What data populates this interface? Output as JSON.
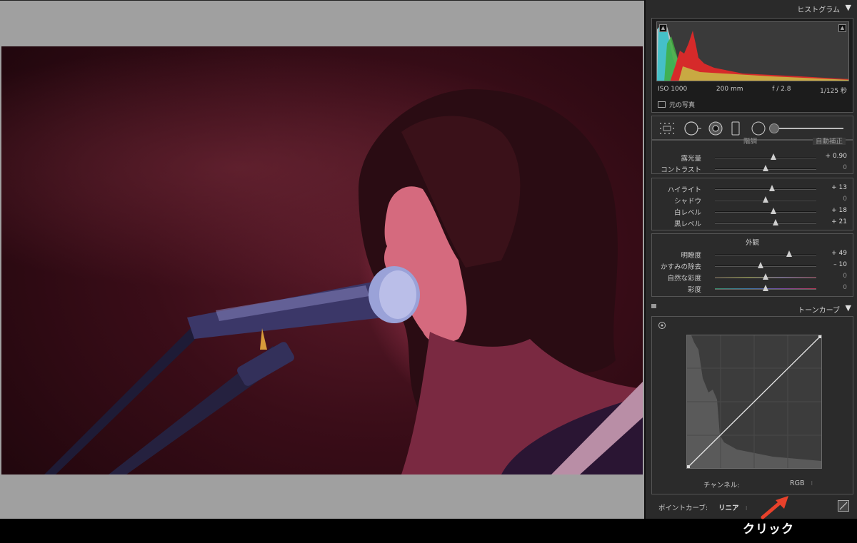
{
  "histogram": {
    "title": "ヒストグラム",
    "exif": {
      "iso": "ISO 1000",
      "focal": "200 mm",
      "aperture": "f / 2.8",
      "shutter": "1/125 秒"
    },
    "original_photo_label": "元の写真"
  },
  "basic": {
    "partial_header_left": "階調",
    "partial_header_right": "自動補正",
    "group1": [
      {
        "label": "露光量",
        "value": "+ 0.90",
        "position": 0.58
      },
      {
        "label": "コントラスト",
        "value": "0",
        "position": 0.5
      }
    ],
    "group2": [
      {
        "label": "ハイライト",
        "value": "+ 13",
        "position": 0.56
      },
      {
        "label": "シャドウ",
        "value": "0",
        "position": 0.5
      },
      {
        "label": "白レベル",
        "value": "+ 18",
        "position": 0.58
      },
      {
        "label": "黒レベル",
        "value": "+ 21",
        "position": 0.6
      }
    ],
    "appearance_title": "外観",
    "group3": [
      {
        "label": "明瞭度",
        "value": "+ 49",
        "position": 0.73
      },
      {
        "label": "かすみの除去",
        "value": "– 10",
        "position": 0.45
      },
      {
        "label": "自然な彩度",
        "value": "0",
        "position": 0.5,
        "style": "vibrance"
      },
      {
        "label": "彩度",
        "value": "0",
        "position": 0.5,
        "style": "saturation"
      }
    ]
  },
  "tone_curve": {
    "title": "トーンカーブ",
    "channel_label": "チャンネル:",
    "channel_value": "RGB",
    "point_curve_label": "ポイントカーブ:",
    "point_curve_value": "リニア"
  },
  "annotation": {
    "text": "クリック",
    "color": "#e8412b"
  },
  "colors": {
    "panel_bg": "#2a2a2a",
    "preview_bg": "#a0a0a0"
  }
}
